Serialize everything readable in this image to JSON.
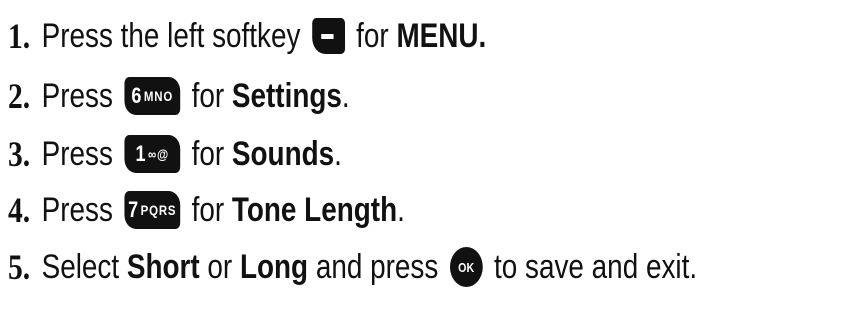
{
  "steps": [
    {
      "num": "1.",
      "pre": "Press the left softkey",
      "key_icon": "left-softkey-icon",
      "mid": "for",
      "bold": "MENU.",
      "post": ""
    },
    {
      "num": "2.",
      "pre": "Press",
      "key_icon": "key-6-mno-icon",
      "key_digit": "6",
      "key_letters": "MNO",
      "mid": "for",
      "bold": "Settings",
      "post": "."
    },
    {
      "num": "3.",
      "pre": "Press",
      "key_icon": "key-1-voicemail-icon",
      "key_digit": "1",
      "key_letters": "∞@",
      "mid": "for",
      "bold": "Sounds",
      "post": "."
    },
    {
      "num": "4.",
      "pre": "Press",
      "key_icon": "key-7-pqrs-icon",
      "key_digit": "7",
      "key_letters": "PQRS",
      "mid": "for",
      "bold": "Tone Length",
      "post": "."
    },
    {
      "num": "5.",
      "pre": "Select",
      "opt1": "Short",
      "or": "or",
      "opt2": "Long",
      "and": "and press",
      "key_icon": "ok-key-icon",
      "key_label": "OK",
      "post": "to save and exit."
    }
  ]
}
